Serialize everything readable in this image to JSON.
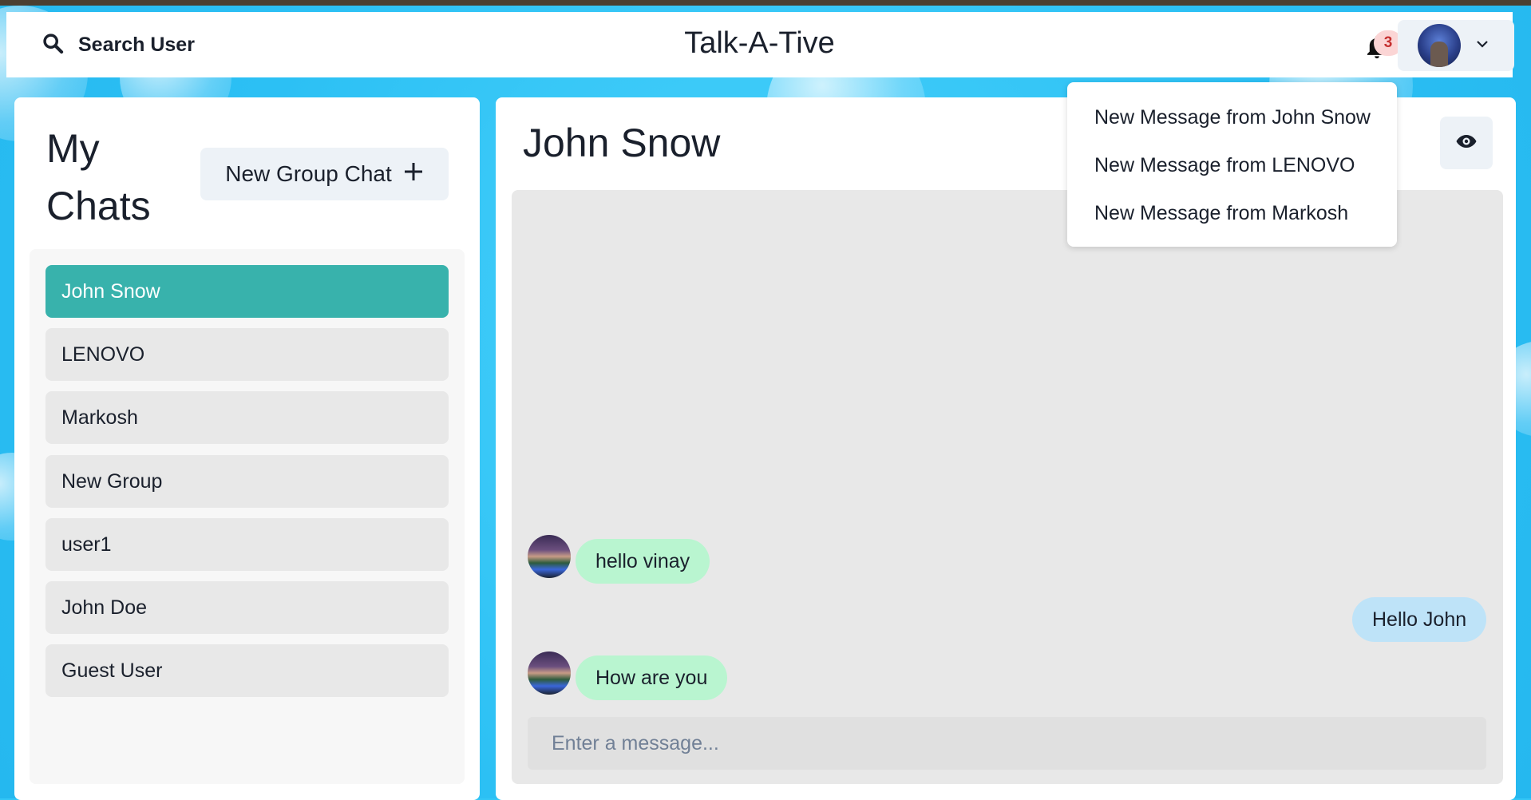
{
  "header": {
    "search_label": "Search User",
    "app_title": "Talk-A-Tive",
    "notification_count": "3"
  },
  "notifications": [
    "New Message from John Snow",
    "New Message from LENOVO",
    "New Message from Markosh"
  ],
  "sidebar": {
    "title_line1": "My",
    "title_line2": "Chats",
    "new_group_label": "New Group Chat",
    "chats": [
      {
        "name": "John Snow",
        "active": true
      },
      {
        "name": "LENOVO",
        "active": false
      },
      {
        "name": "Markosh",
        "active": false
      },
      {
        "name": "New Group",
        "active": false
      },
      {
        "name": "user1",
        "active": false
      },
      {
        "name": "John Doe",
        "active": false
      },
      {
        "name": "Guest User",
        "active": false
      }
    ]
  },
  "chat": {
    "title": "John Snow",
    "messages": [
      {
        "text": "hello vinay",
        "direction": "in"
      },
      {
        "text": "Hello John",
        "direction": "out"
      },
      {
        "text": "How are you",
        "direction": "in"
      }
    ],
    "input_placeholder": "Enter a message..."
  },
  "colors": {
    "accent_active": "#38b2ac",
    "incoming_bubble": "#b9f5d0",
    "outgoing_bubble": "#bee3f8",
    "badge": "#fbd5d5"
  }
}
